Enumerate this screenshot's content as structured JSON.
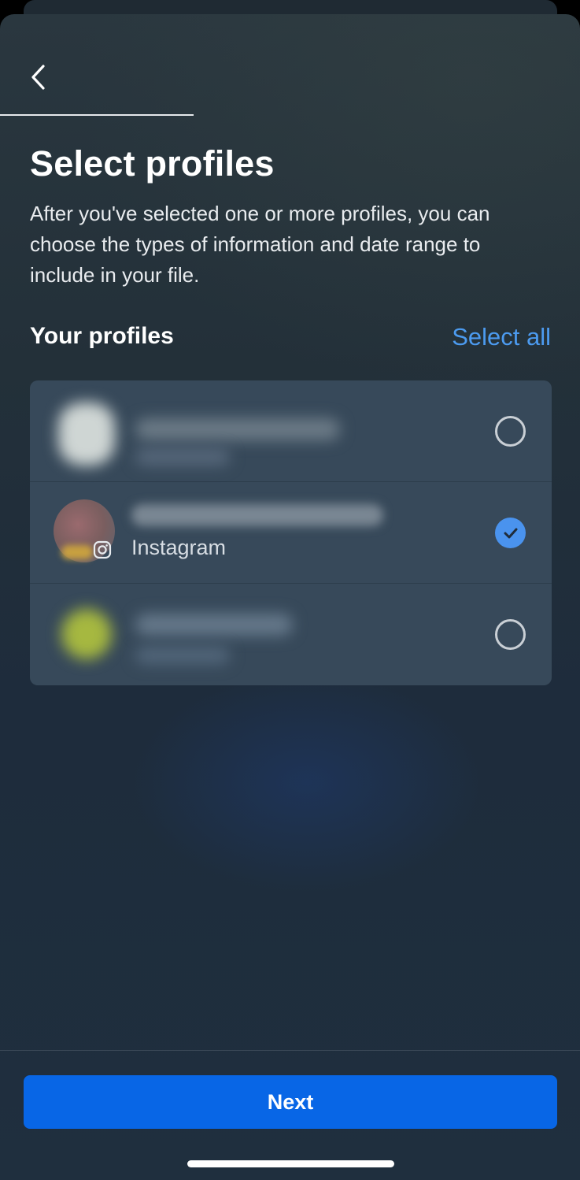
{
  "header": {
    "back_icon": "chevron-left-icon"
  },
  "page": {
    "title": "Select profiles",
    "description": "After you've selected one or more profiles, you can choose the types of information and date range to include in your file."
  },
  "profiles_section": {
    "title": "Your profiles",
    "select_all_label": "Select all",
    "items": [
      {
        "name": "",
        "platform": "",
        "selected": false
      },
      {
        "name": "",
        "platform": "Instagram",
        "platform_icon": "instagram-icon",
        "selected": true
      },
      {
        "name": "",
        "platform": "",
        "selected": false
      }
    ]
  },
  "footer": {
    "next_label": "Next"
  },
  "colors": {
    "accent": "#0866e6",
    "link": "#4c9bf0",
    "card": "#37495a"
  }
}
